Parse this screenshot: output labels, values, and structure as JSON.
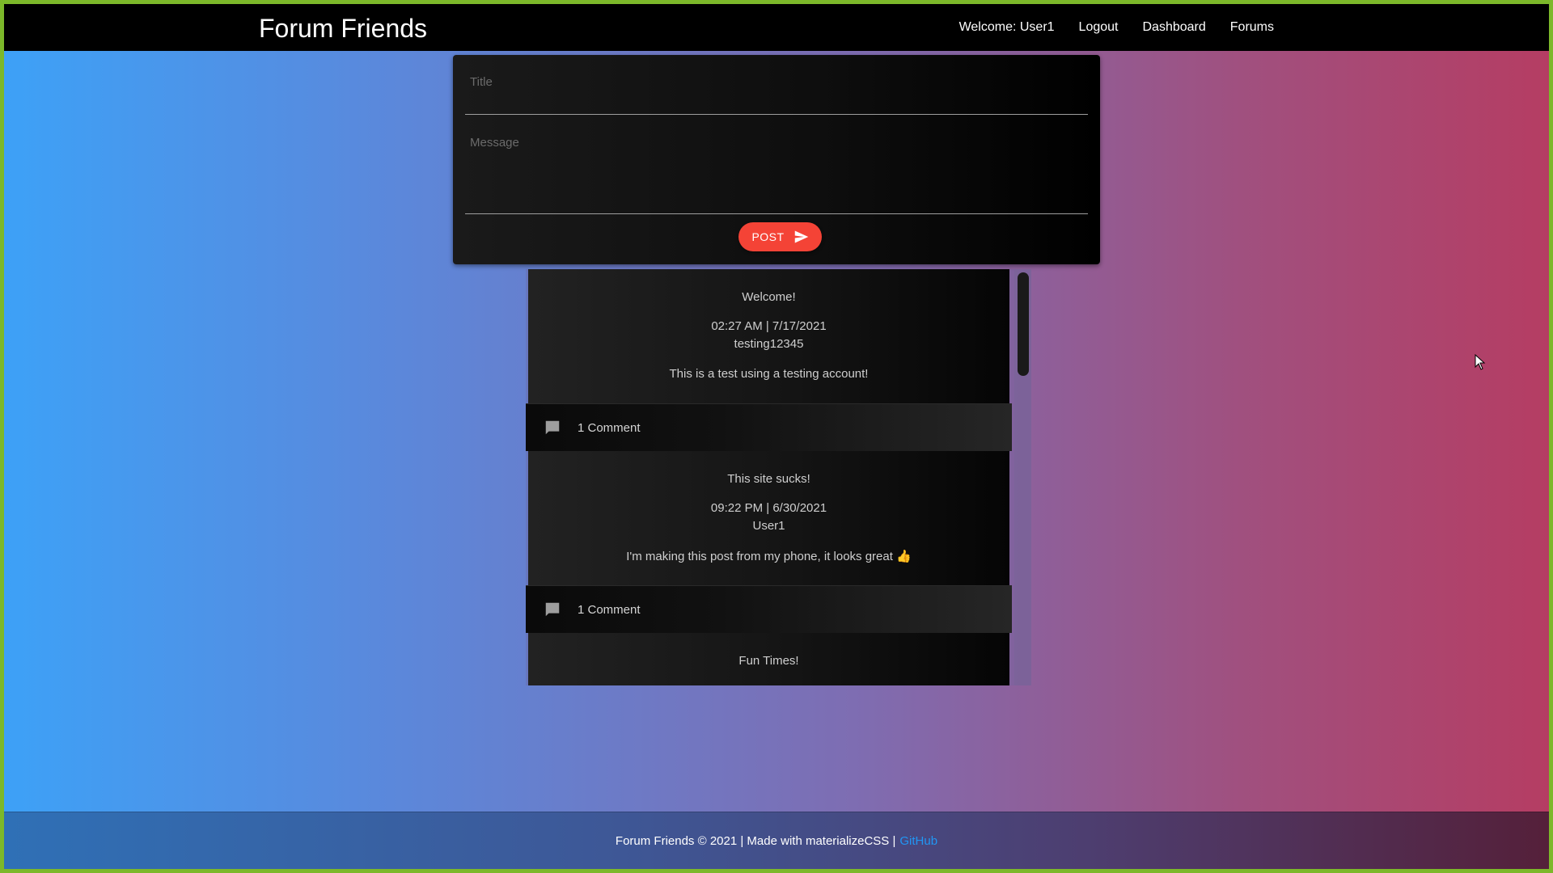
{
  "navbar": {
    "brand": "Forum Friends",
    "welcome": "Welcome: User1",
    "logout": "Logout",
    "dashboard": "Dashboard",
    "forums": "Forums"
  },
  "form": {
    "title_placeholder": "Title",
    "message_placeholder": "Message",
    "post_label": "POST",
    "title_value": "",
    "message_value": ""
  },
  "posts": [
    {
      "title": "Welcome!",
      "date": "02:27 AM | 7/17/2021",
      "author": "testing12345",
      "message": "This is a test using a testing account!",
      "comments": "1 Comment"
    },
    {
      "title": "This site sucks!",
      "date": "09:22 PM | 6/30/2021",
      "author": "User1",
      "message": "I'm making this post from my phone, it looks great 👍",
      "comments": "1 Comment"
    },
    {
      "title": "Fun Times!"
    }
  ],
  "footer": {
    "text": "Forum Friends © 2021 | Made with materializeCSS |",
    "link": "GitHub"
  },
  "colors": {
    "post_button": "#f44336",
    "link": "#2196f3",
    "border": "#7cb82a"
  },
  "icons": {
    "send": "send-icon",
    "comment": "comment-icon"
  }
}
